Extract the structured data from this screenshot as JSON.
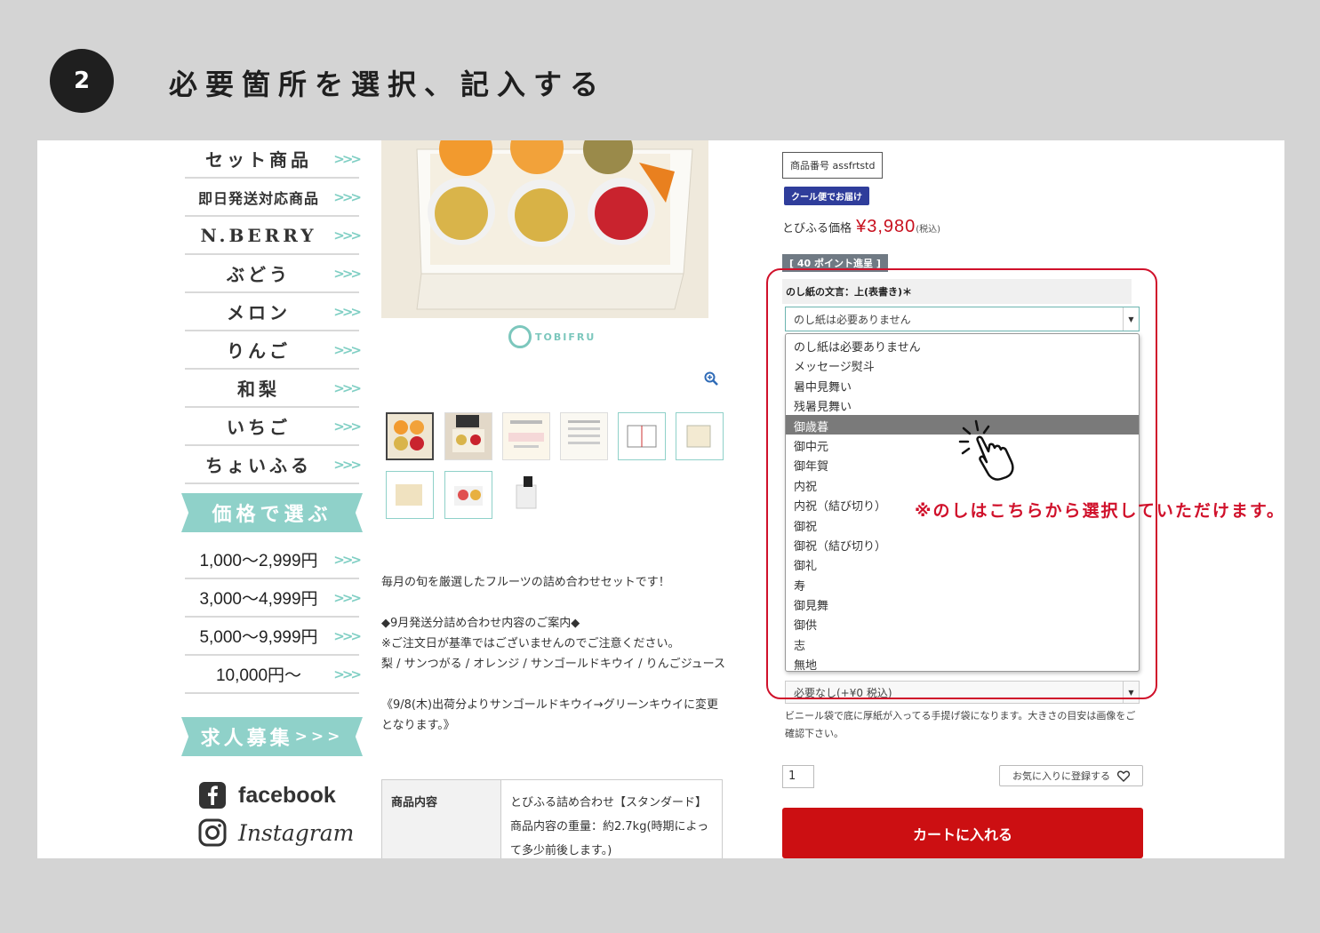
{
  "step": {
    "number": "2",
    "title": "必要箇所を選択、記入する"
  },
  "sidebar": {
    "categories": [
      {
        "label": "セット商品",
        "small": false
      },
      {
        "label": "即日発送対応商品",
        "small": true
      },
      {
        "label": "N.BERRY",
        "small": false
      },
      {
        "label": "ぶどう",
        "small": false
      },
      {
        "label": "メロン",
        "small": false
      },
      {
        "label": "りんご",
        "small": false
      },
      {
        "label": "和梨",
        "small": false
      },
      {
        "label": "いちご",
        "small": false
      },
      {
        "label": "ちょいふる",
        "small": false
      }
    ],
    "chevron": ">>>",
    "price_header": "価格で選ぶ",
    "price_ranges": [
      "1,000〜2,999円",
      "3,000〜4,999円",
      "5,000〜9,999円",
      "10,000円〜"
    ],
    "recruit_label": "求人募集",
    "facebook_label": "facebook",
    "instagram_label": "Instagram"
  },
  "brand": {
    "name": "TOBIFRU"
  },
  "description": {
    "line1": "毎月の旬を厳選したフルーツの詰め合わせセットです！",
    "heading": "◆9月発送分詰め合わせ内容のご案内◆",
    "note": "※ご注文日が基準ではございませんのでご注意ください。",
    "contents": "梨 / サンつがる / オレンジ / サンゴールドキウイ / りんごジュース",
    "change_note": "《9/8(木)出荷分よりサンゴールドキウイ→グリーンキウイに変更となります。》"
  },
  "spec_table": {
    "header": "商品内容",
    "value": "とびふる詰め合わせ【スタンダード】商品内容の重量：約2.7kg(時期によって多少前後します。)"
  },
  "product": {
    "sku_label": "商品番号 assfrtstd",
    "cool_badge": "クール便でお届け",
    "price_label": "とびふる価格",
    "price": "¥3,980",
    "tax": "(税込)",
    "points": "[ 40 ポイント進呈 ]"
  },
  "noshi": {
    "label": "のし紙の文言：上(表書き)＊",
    "selected_value": "のし紙は必要ありません",
    "options": [
      "のし紙は必要ありません",
      "メッセージ熨斗",
      "暑中見舞い",
      "残暑見舞い",
      "御歳暮",
      "御中元",
      "御年賀",
      "内祝",
      "内祝（結び切り）",
      "御祝",
      "御祝（結び切り）",
      "御礼",
      "寿",
      "御見舞",
      "御供",
      "志",
      "無地"
    ],
    "highlighted_option": "御歳暮"
  },
  "bag": {
    "selected_value": "必要なし(+¥0 税込)",
    "note": "ビニール袋で底に厚紙が入ってる手提げ袋になります。大きさの目安は画像をご確認下さい。"
  },
  "annotation": "※のしはこちらから選択していただけます。",
  "purchase": {
    "quantity": "1",
    "favorite_label": "お気に入りに登録する",
    "cart_label": "カートに入れる"
  },
  "colors": {
    "accent_red": "#d0112b",
    "teal": "#8fd1c9",
    "cart_red": "#cc0f12",
    "badge_blue": "#2f3d9b"
  }
}
